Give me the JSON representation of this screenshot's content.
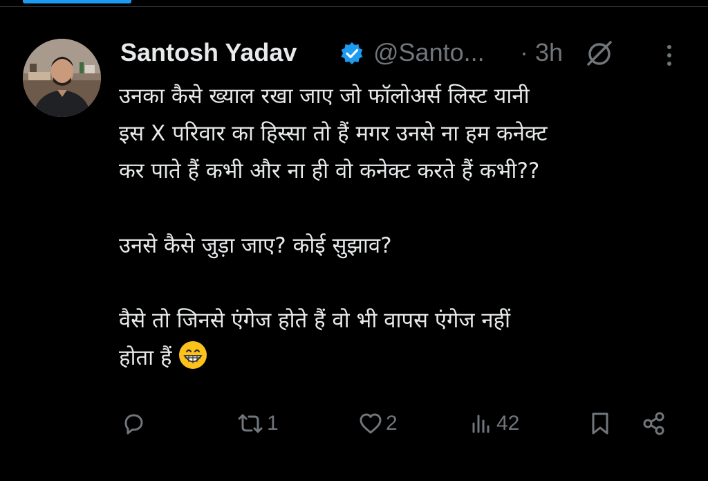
{
  "colors": {
    "background": "#000000",
    "text_primary": "#e7e9ea",
    "text_secondary": "#71767b",
    "verified_blue": "#1d9bf0",
    "tab_indicator": "#1d9bf0",
    "divider": "#2f3336"
  },
  "post": {
    "author": {
      "display_name": "Santosh Yadav",
      "handle": "@Santo...",
      "verified": true,
      "avatar_icon": "profile-photo"
    },
    "timestamp": "· 3h",
    "icons": {
      "grok": "grok-icon",
      "more": "more-vertical-icon"
    },
    "body": {
      "paragraph_1": {
        "line_1": "उनका कैसे ख्याल रखा जाए जो फॉलोअर्स लिस्ट यानी",
        "line_2": "इस X परिवार का हिस्सा तो हैं मगर उनसे ना हम कनेक्ट",
        "line_3": "कर पाते हैं कभी और ना ही वो कनेक्ट करते हैं कभी??"
      },
      "paragraph_2": {
        "line_1": "उनसे कैसे जुड़ा जाए? कोई सुझाव?"
      },
      "paragraph_3": {
        "line_1": "वैसे तो जिनसे एंगेज होते हैं वो भी वापस एंगेज नहीं",
        "line_2": "होता हैं",
        "emoji": "grinning-face-emoji"
      }
    },
    "actions": {
      "reply": {
        "icon": "reply-icon",
        "count": ""
      },
      "repost": {
        "icon": "repost-icon",
        "count": "1"
      },
      "like": {
        "icon": "heart-icon",
        "count": "2"
      },
      "views": {
        "icon": "views-icon",
        "count": "42"
      },
      "bookmark": {
        "icon": "bookmark-icon"
      },
      "share": {
        "icon": "share-icon"
      }
    }
  }
}
